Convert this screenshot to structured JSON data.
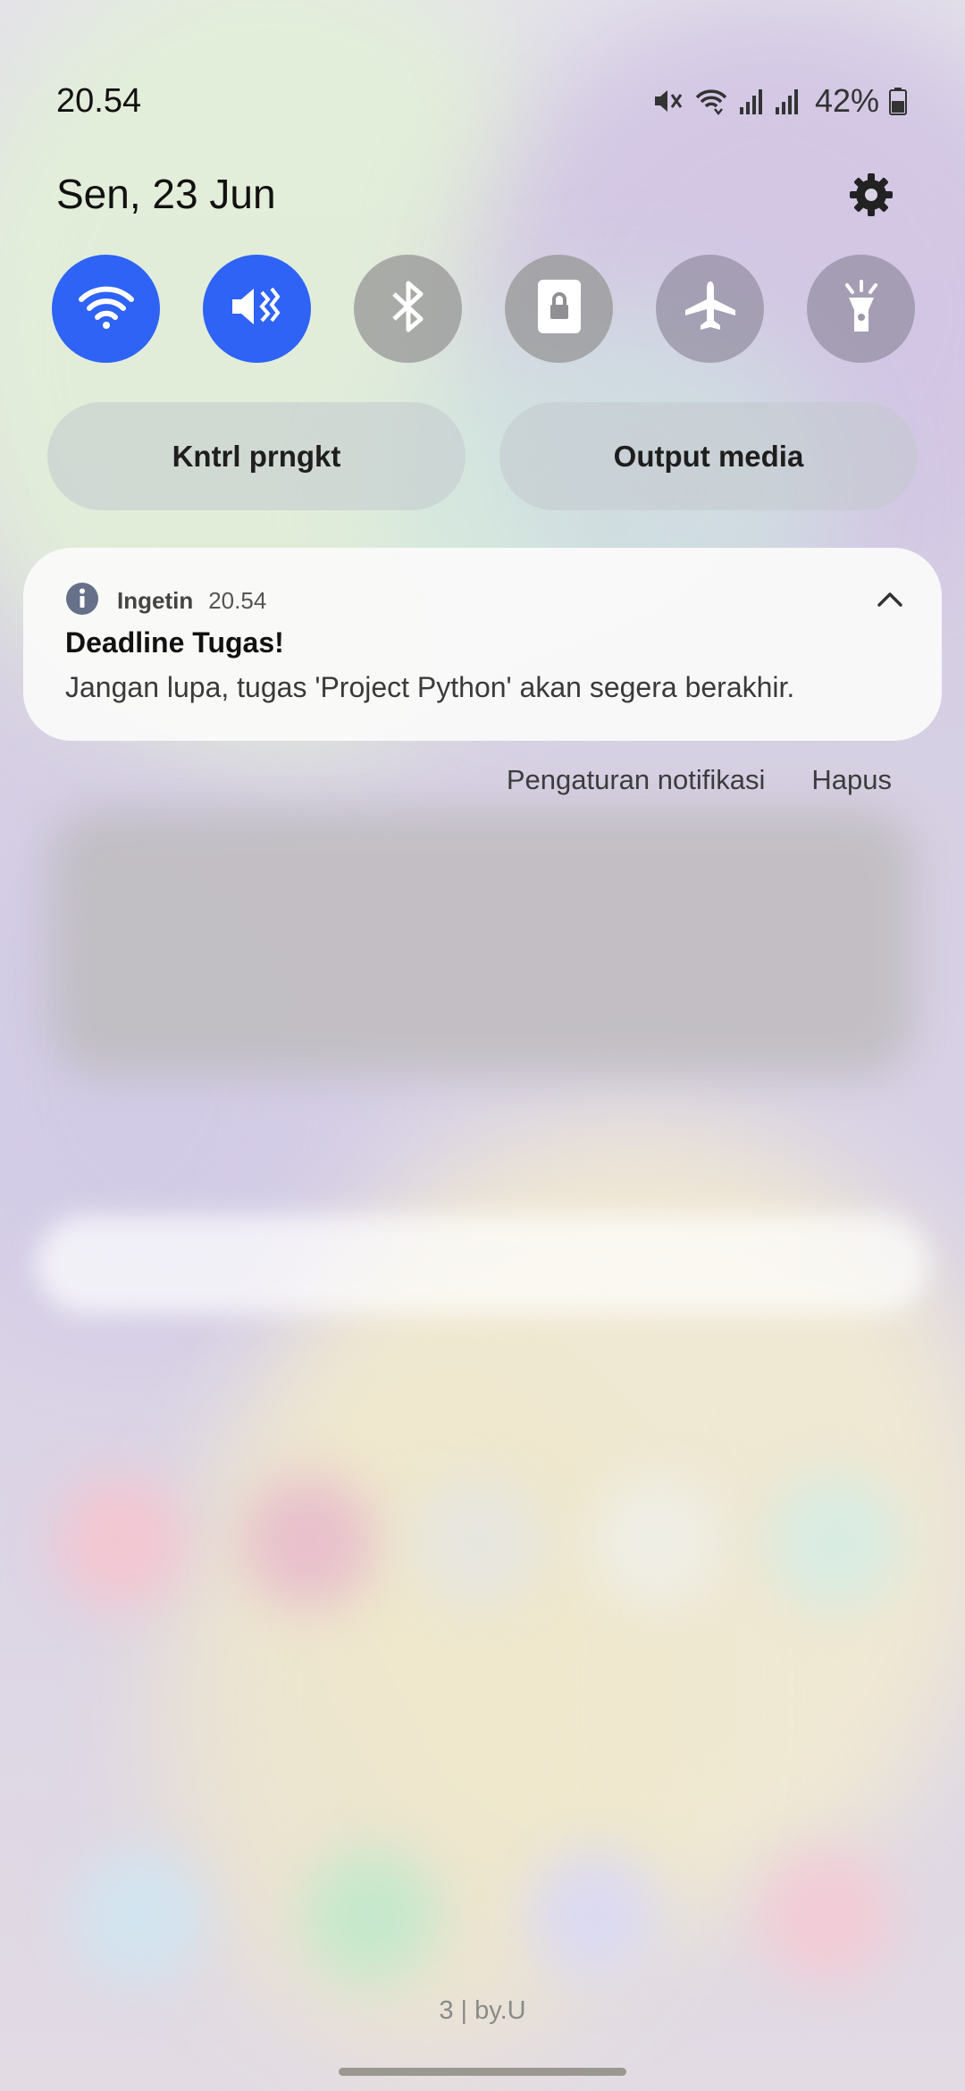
{
  "status_bar": {
    "time": "20.54",
    "battery_percent": "42%",
    "icons": [
      "mute-icon",
      "wifi-icon",
      "signal-1-icon",
      "signal-2-icon",
      "battery-icon"
    ]
  },
  "header": {
    "date": "Sen, 23 Jun",
    "settings_icon": "gear-icon"
  },
  "quick_settings": [
    {
      "icon": "wifi-icon",
      "state": "on"
    },
    {
      "icon": "mute-icon",
      "state": "on"
    },
    {
      "icon": "bluetooth-icon",
      "state": "off"
    },
    {
      "icon": "screen-lock-icon",
      "state": "off"
    },
    {
      "icon": "airplane-icon",
      "state": "off"
    },
    {
      "icon": "flashlight-icon",
      "state": "off"
    }
  ],
  "pills": {
    "device_control": "Kntrl prngkt",
    "media_output": "Output media"
  },
  "notification": {
    "app": "Ingetin",
    "time": "20.54",
    "title": "Deadline Tugas!",
    "body": "Jangan lupa, tugas 'Project Python' akan segera berakhir.",
    "icon": "info-icon"
  },
  "notification_actions": {
    "settings": "Pengaturan notifikasi",
    "clear": "Hapus"
  },
  "carrier": "3 | by.U",
  "colors": {
    "accent": "#2e63f5"
  }
}
